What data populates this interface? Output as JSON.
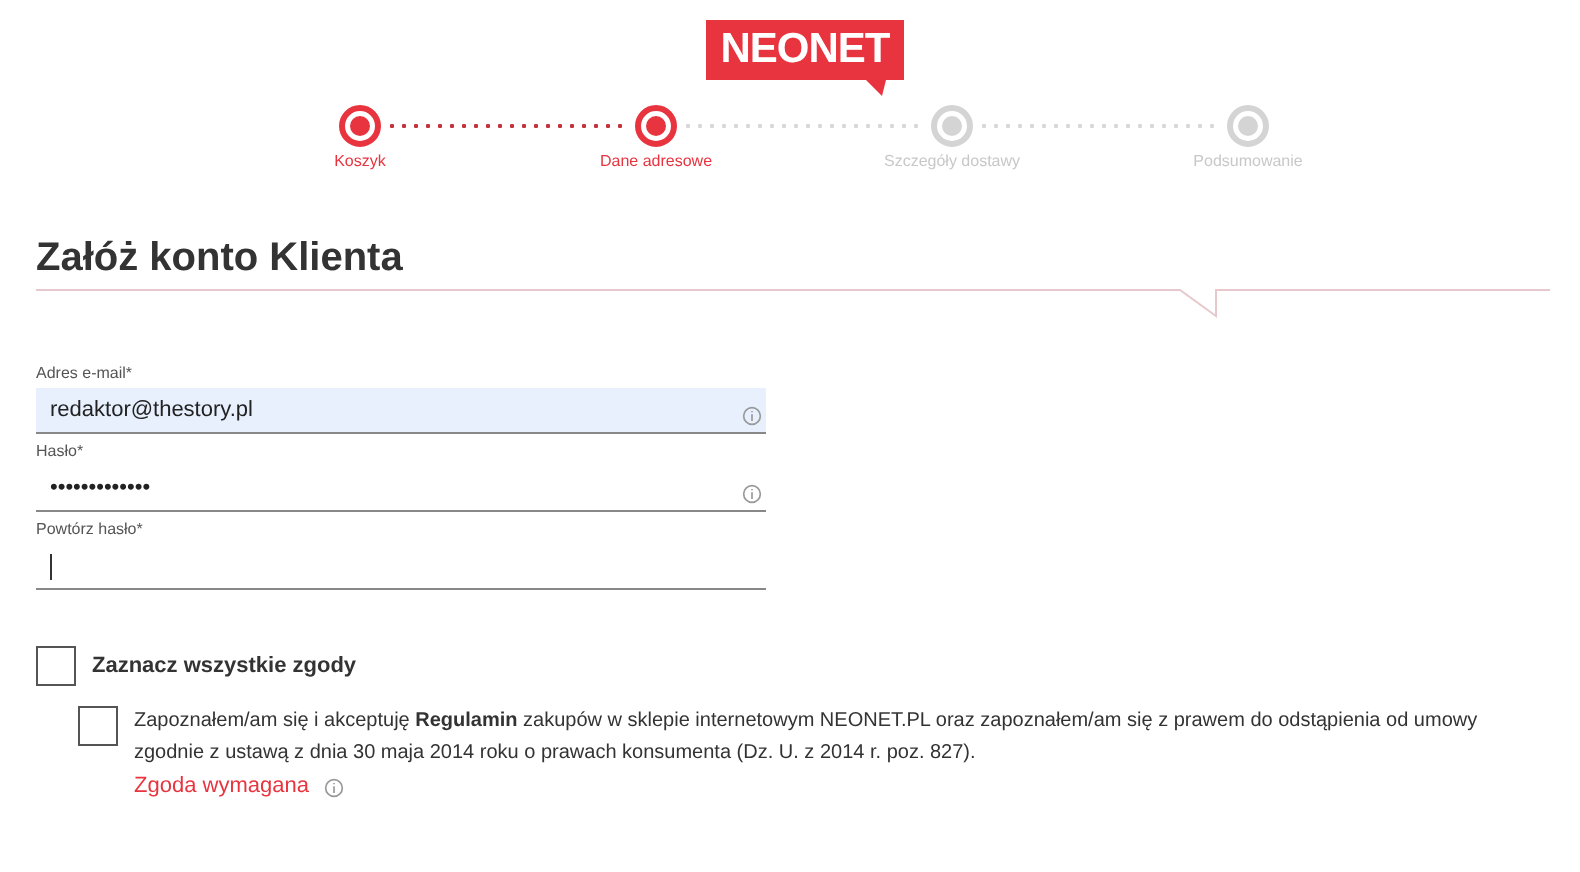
{
  "logo": "NEONET",
  "steps": [
    {
      "label": "Koszyk",
      "active": true
    },
    {
      "label": "Dane adresowe",
      "active": true
    },
    {
      "label": "Szczegóły dostawy",
      "active": false
    },
    {
      "label": "Podsumowanie",
      "active": false
    }
  ],
  "heading": "Załóż konto Klienta",
  "fields": [
    {
      "label": "Adres e-mail*",
      "value": "redaktor@thestory.pl",
      "autofilled": true,
      "focused": false,
      "info": true
    },
    {
      "label": "Hasło*",
      "value": "•••••••••••••",
      "autofilled": false,
      "focused": false,
      "info": true
    },
    {
      "label": "Powtórz hasło*",
      "autofilled": false,
      "focused": true,
      "info": false
    }
  ],
  "select_all": {
    "label": "Zaznacz wszystkie zgody",
    "checked": false
  },
  "consents": [
    {
      "text": "Zapoznałem/am się i akceptuję **Regulamin** zakupów w sklepie internetowym NEONET.PL oraz zapoznałem/am się z prawem do odstąpienia od umowy zgodnie z ustawą z dnia 30 maja 2014 roku o prawach konsumenta (Dz. U. z 2014 r. poz. 827).",
      "checked": false,
      "required_note": "Zgoda wymagana"
    }
  ]
}
